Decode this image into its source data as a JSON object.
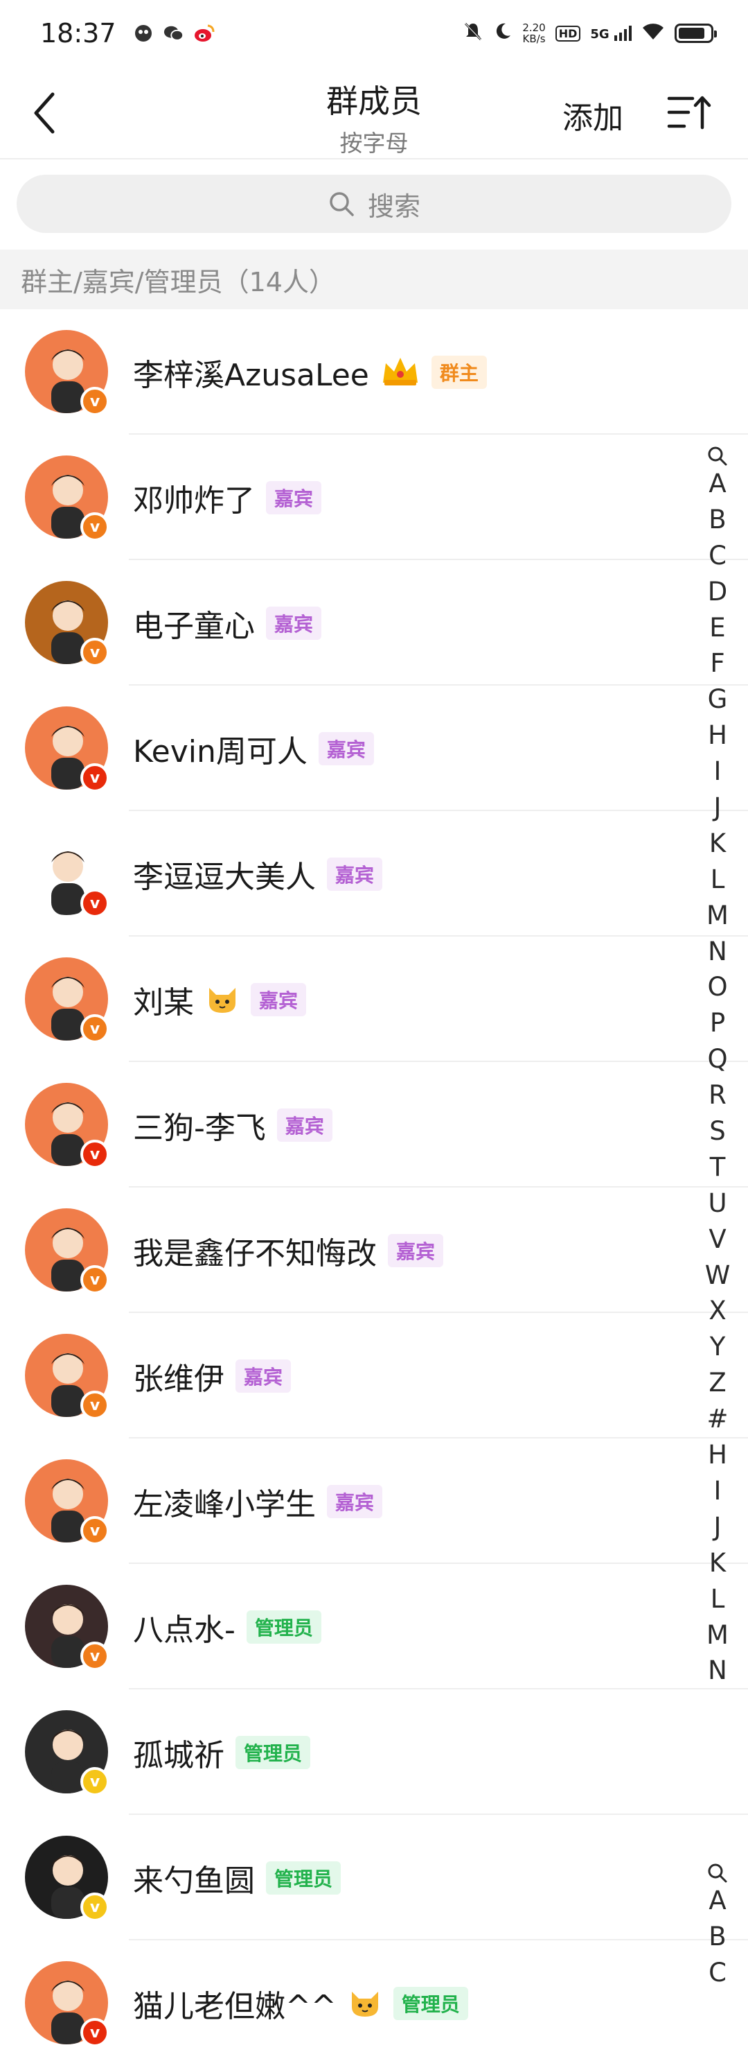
{
  "status_bar": {
    "time": "18:37",
    "net_speed_value": "2.20",
    "net_speed_unit": "KB/s",
    "hd_label": "HD",
    "signal_label": "5G",
    "battery_level": 0.85
  },
  "header": {
    "title": "群成员",
    "subtitle": "按字母",
    "add_label": "添加"
  },
  "search": {
    "placeholder": "搜索"
  },
  "section": {
    "title": "群主/嘉宾/管理员（14人）"
  },
  "members": [
    {
      "name": "李梓溪AzusaLee",
      "extra_icon": "crown-icon",
      "role": "群主",
      "role_type": "owner",
      "verify_color": "#f07c1a"
    },
    {
      "name": "邓帅炸了",
      "role": "嘉宾",
      "role_type": "guest",
      "verify_color": "#f07c1a"
    },
    {
      "name": "电子童心",
      "role": "嘉宾",
      "role_type": "guest",
      "verify_color": "#f07c1a"
    },
    {
      "name": "Kevin周可人",
      "role": "嘉宾",
      "role_type": "guest",
      "verify_color": "#e82a0a"
    },
    {
      "name": "李逗逗大美人",
      "role": "嘉宾",
      "role_type": "guest",
      "verify_color": "#e82a0a"
    },
    {
      "name": "刘某",
      "extra_icon": "cat-emoji-icon",
      "role": "嘉宾",
      "role_type": "guest",
      "verify_color": "#f07c1a"
    },
    {
      "name": "三狗-李飞",
      "role": "嘉宾",
      "role_type": "guest",
      "verify_color": "#e82a0a"
    },
    {
      "name": "我是鑫仔不知悔改",
      "role": "嘉宾",
      "role_type": "guest",
      "verify_color": "#f07c1a"
    },
    {
      "name": "张维伊",
      "role": "嘉宾",
      "role_type": "guest",
      "verify_color": "#f07c1a"
    },
    {
      "name": "左凌峰小学生",
      "role": "嘉宾",
      "role_type": "guest",
      "verify_color": "#f07c1a"
    },
    {
      "name": "八点水-",
      "role": "管理员",
      "role_type": "admin",
      "verify_color": "#f07c1a"
    },
    {
      "name": "孤城祈",
      "role": "管理员",
      "role_type": "admin",
      "verify_color": "#f5c518"
    },
    {
      "name": "来勺鱼圆",
      "role": "管理员",
      "role_type": "admin",
      "verify_color": "#f5c518"
    },
    {
      "name": "猫儿老但嫩^^",
      "extra_icon": "cat-emoji-icon",
      "role": "管理员",
      "role_type": "admin",
      "verify_color": "#e82a0a"
    }
  ],
  "alphabet_index": [
    "A",
    "B",
    "C",
    "D",
    "E",
    "F",
    "G",
    "H",
    "I",
    "J",
    "K",
    "L",
    "M",
    "N",
    "O",
    "P",
    "Q",
    "R",
    "S",
    "T",
    "U",
    "V",
    "W",
    "X",
    "Y",
    "Z",
    "#",
    "H",
    "I",
    "J",
    "K",
    "L",
    "M",
    "N"
  ],
  "alphabet_index_bottom": [
    "A",
    "B",
    "C"
  ],
  "verify_mark": "v",
  "colors": {
    "owner_badge": "#f08a1c",
    "guest_badge": "#b461d3",
    "admin_badge": "#22b24c",
    "section_bg": "#f3f3f3"
  }
}
